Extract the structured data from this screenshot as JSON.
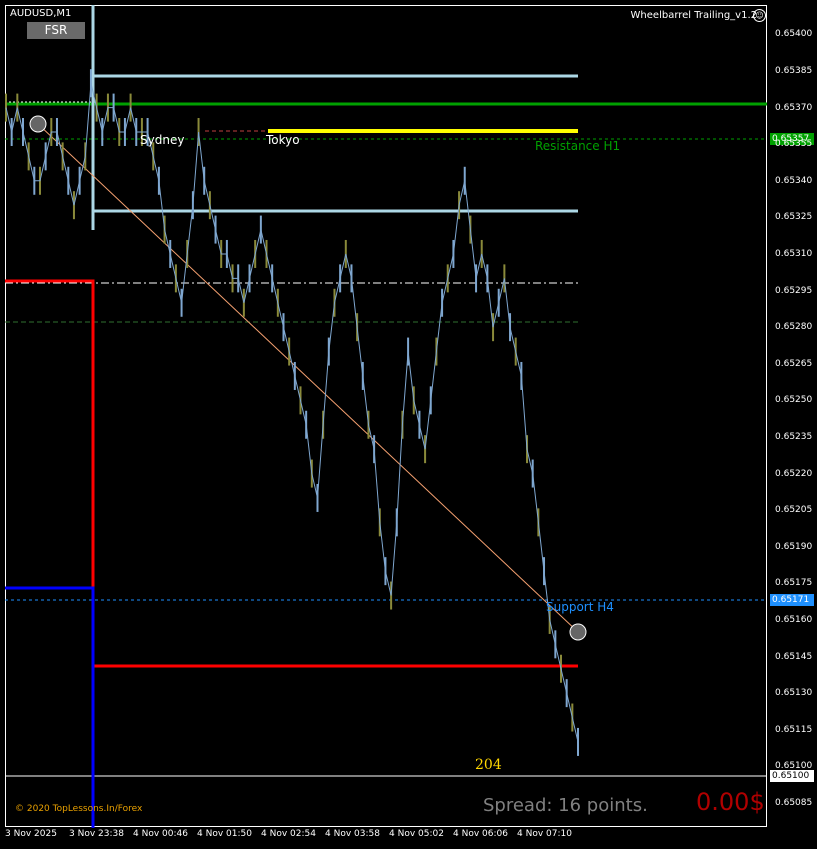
{
  "chart": {
    "symbol_label": "AUDUSD,M1",
    "fsr_button": "FSR",
    "ea_name": "Wheelbarrel Trailing_v1.2",
    "ea_icon": "smiley-icon",
    "copyright": "© 2020 TopLessons.In/Forex",
    "spread_text": "Spread: 16 points.",
    "profit_text": "0.00$",
    "count_text": "204",
    "sessions": [
      "Sydney",
      "Tokyo"
    ],
    "levels": {
      "resistance_h1": "Resistance H1",
      "support_h4": "Support H4"
    },
    "price_tags": {
      "resistance": "0.65357",
      "support": "0.65171",
      "current": "0.65100"
    },
    "colors": {
      "resistance": "#00a000",
      "support": "#1e90ff",
      "candle_up": "#8a8a3a",
      "candle_down": "#7fa7d0",
      "red_box": "#ff0000",
      "blue_box": "#0000ff",
      "yellow": "#ffff00",
      "lightblue": "#add8e6"
    }
  },
  "chart_data": {
    "type": "line",
    "title": "",
    "xlabel": "",
    "ylabel": "",
    "ylim": [
      0.65078,
      0.6541
    ],
    "y_ticks": [
      "0.65400",
      "0.65385",
      "0.65370",
      "0.65355",
      "0.65340",
      "0.65325",
      "0.65310",
      "0.65295",
      "0.65280",
      "0.65265",
      "0.65250",
      "0.65235",
      "0.65220",
      "0.65205",
      "0.65190",
      "0.65175",
      "0.65160",
      "0.65145",
      "0.65130",
      "0.65115",
      "0.65100",
      "0.65085"
    ],
    "x_ticks": [
      "3 Nov 2025",
      "3 Nov 23:38",
      "4 Nov 00:46",
      "4 Nov 01:50",
      "4 Nov 02:54",
      "4 Nov 03:58",
      "4 Nov 05:02",
      "4 Nov 06:06",
      "4 Nov 07:10"
    ],
    "series": [
      {
        "values": [
          0.6537,
          0.6536,
          0.6537,
          0.6536,
          0.6535,
          0.6534,
          0.6534,
          0.6535,
          0.6536,
          0.6536,
          0.6535,
          0.6534,
          0.6533,
          0.6534,
          0.6535,
          0.6538,
          0.6537,
          0.6536,
          0.6537,
          0.6537,
          0.6536,
          0.6536,
          0.6537,
          0.6536,
          0.6536,
          0.6536,
          0.6535,
          0.6534,
          0.6532,
          0.6531,
          0.653,
          0.6529,
          0.6531,
          0.6533,
          0.6536,
          0.6534,
          0.6533,
          0.6532,
          0.6531,
          0.6531,
          0.653,
          0.653,
          0.6529,
          0.653,
          0.6531,
          0.6532,
          0.6531,
          0.653,
          0.6529,
          0.6528,
          0.6527,
          0.6526,
          0.6525,
          0.6524,
          0.6522,
          0.6521,
          0.6524,
          0.6527,
          0.6529,
          0.653,
          0.6531,
          0.653,
          0.6528,
          0.6526,
          0.6524,
          0.6523,
          0.652,
          0.6518,
          0.6517,
          0.652,
          0.6524,
          0.6527,
          0.6525,
          0.6524,
          0.6523,
          0.6525,
          0.6527,
          0.6529,
          0.653,
          0.6531,
          0.6533,
          0.6534,
          0.6532,
          0.653,
          0.6531,
          0.653,
          0.6528,
          0.6529,
          0.653,
          0.6528,
          0.6527,
          0.6526,
          0.6523,
          0.6522,
          0.652,
          0.6518,
          0.6516,
          0.6515,
          0.6514,
          0.6513,
          0.6512,
          0.6511
        ]
      }
    ]
  }
}
